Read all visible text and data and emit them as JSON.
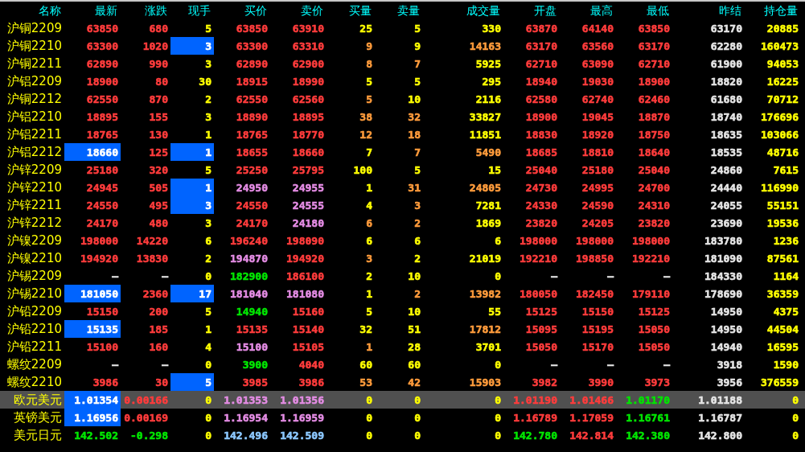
{
  "columns": [
    "名称",
    "最新",
    "涨跌",
    "现手",
    "买价",
    "卖价",
    "买量",
    "卖量",
    "成交量",
    "开盘",
    "最高",
    "最低",
    "昨结",
    "持仓量"
  ],
  "rows": [
    {
      "name": "沪铜2209",
      "selected": false,
      "cells": [
        {
          "text": "63850",
          "color": "#ff3c3c",
          "highlighted": false
        },
        {
          "text": "680",
          "color": "#ff3c3c",
          "highlighted": false
        },
        {
          "text": "5",
          "color": "#ffff00",
          "highlighted": false
        },
        {
          "text": "63850",
          "color": "#ff3c3c",
          "highlighted": false
        },
        {
          "text": "63910",
          "color": "#ff3c3c",
          "highlighted": false
        },
        {
          "text": "25",
          "color": "#ffff00",
          "highlighted": false
        },
        {
          "text": "5",
          "color": "#ffff00",
          "highlighted": false
        },
        {
          "text": "330",
          "color": "#ffff00",
          "highlighted": false
        },
        {
          "text": "63870",
          "color": "#ff3c3c",
          "highlighted": false
        },
        {
          "text": "64140",
          "color": "#ff3c3c",
          "highlighted": false
        },
        {
          "text": "63850",
          "color": "#ff3c3c",
          "highlighted": false
        },
        {
          "text": "63170",
          "color": "#e6e6e6",
          "highlighted": false
        },
        {
          "text": "20885",
          "color": "#ffff00",
          "highlighted": false
        }
      ]
    },
    {
      "name": "沪铜2210",
      "selected": false,
      "cells": [
        {
          "text": "63300",
          "color": "#ff3c3c",
          "highlighted": false
        },
        {
          "text": "1020",
          "color": "#ff3c3c",
          "highlighted": false
        },
        {
          "text": "3",
          "color": "#ffffff",
          "highlighted": true
        },
        {
          "text": "63300",
          "color": "#ff3c3c",
          "highlighted": false
        },
        {
          "text": "63310",
          "color": "#ff3c3c",
          "highlighted": false
        },
        {
          "text": "9",
          "color": "#ff9c3c",
          "highlighted": false
        },
        {
          "text": "9",
          "color": "#ffff00",
          "highlighted": false
        },
        {
          "text": "14163",
          "color": "#ff9c3c",
          "highlighted": false
        },
        {
          "text": "63170",
          "color": "#ff3c3c",
          "highlighted": false
        },
        {
          "text": "63560",
          "color": "#ff3c3c",
          "highlighted": false
        },
        {
          "text": "63170",
          "color": "#ff3c3c",
          "highlighted": false
        },
        {
          "text": "62280",
          "color": "#e6e6e6",
          "highlighted": false
        },
        {
          "text": "160473",
          "color": "#ffff00",
          "highlighted": false
        }
      ]
    },
    {
      "name": "沪铜2211",
      "selected": false,
      "cells": [
        {
          "text": "62890",
          "color": "#ff3c3c",
          "highlighted": false
        },
        {
          "text": "990",
          "color": "#ff3c3c",
          "highlighted": false
        },
        {
          "text": "3",
          "color": "#ffff00",
          "highlighted": false
        },
        {
          "text": "62890",
          "color": "#ff3c3c",
          "highlighted": false
        },
        {
          "text": "62900",
          "color": "#ff3c3c",
          "highlighted": false
        },
        {
          "text": "8",
          "color": "#ff9c3c",
          "highlighted": false
        },
        {
          "text": "7",
          "color": "#ff9c3c",
          "highlighted": false
        },
        {
          "text": "5925",
          "color": "#ffff00",
          "highlighted": false
        },
        {
          "text": "62710",
          "color": "#ff3c3c",
          "highlighted": false
        },
        {
          "text": "63090",
          "color": "#ff3c3c",
          "highlighted": false
        },
        {
          "text": "62710",
          "color": "#ff3c3c",
          "highlighted": false
        },
        {
          "text": "61900",
          "color": "#e6e6e6",
          "highlighted": false
        },
        {
          "text": "94053",
          "color": "#ffff00",
          "highlighted": false
        }
      ]
    },
    {
      "name": "沪铝2209",
      "selected": false,
      "cells": [
        {
          "text": "18900",
          "color": "#ff3c3c",
          "highlighted": false
        },
        {
          "text": "80",
          "color": "#ff3c3c",
          "highlighted": false
        },
        {
          "text": "30",
          "color": "#ffff00",
          "highlighted": false
        },
        {
          "text": "18915",
          "color": "#ff3c3c",
          "highlighted": false
        },
        {
          "text": "18990",
          "color": "#ff3c3c",
          "highlighted": false
        },
        {
          "text": "5",
          "color": "#ffff00",
          "highlighted": false
        },
        {
          "text": "5",
          "color": "#ffff00",
          "highlighted": false
        },
        {
          "text": "295",
          "color": "#ffff00",
          "highlighted": false
        },
        {
          "text": "18940",
          "color": "#ff3c3c",
          "highlighted": false
        },
        {
          "text": "19030",
          "color": "#ff3c3c",
          "highlighted": false
        },
        {
          "text": "18900",
          "color": "#ff3c3c",
          "highlighted": false
        },
        {
          "text": "18820",
          "color": "#e6e6e6",
          "highlighted": false
        },
        {
          "text": "16225",
          "color": "#ffff00",
          "highlighted": false
        }
      ]
    },
    {
      "name": "沪铜2212",
      "selected": false,
      "cells": [
        {
          "text": "62550",
          "color": "#ff3c3c",
          "highlighted": false
        },
        {
          "text": "870",
          "color": "#ff3c3c",
          "highlighted": false
        },
        {
          "text": "2",
          "color": "#ffff00",
          "highlighted": false
        },
        {
          "text": "62550",
          "color": "#ff3c3c",
          "highlighted": false
        },
        {
          "text": "62560",
          "color": "#ff3c3c",
          "highlighted": false
        },
        {
          "text": "5",
          "color": "#ff9c3c",
          "highlighted": false
        },
        {
          "text": "10",
          "color": "#ffff00",
          "highlighted": false
        },
        {
          "text": "2116",
          "color": "#ffff00",
          "highlighted": false
        },
        {
          "text": "62580",
          "color": "#ff3c3c",
          "highlighted": false
        },
        {
          "text": "62740",
          "color": "#ff3c3c",
          "highlighted": false
        },
        {
          "text": "62460",
          "color": "#ff3c3c",
          "highlighted": false
        },
        {
          "text": "61680",
          "color": "#e6e6e6",
          "highlighted": false
        },
        {
          "text": "70712",
          "color": "#ffff00",
          "highlighted": false
        }
      ]
    },
    {
      "name": "沪铝2210",
      "selected": false,
      "cells": [
        {
          "text": "18895",
          "color": "#ff3c3c",
          "highlighted": false
        },
        {
          "text": "155",
          "color": "#ff3c3c",
          "highlighted": false
        },
        {
          "text": "3",
          "color": "#ffff00",
          "highlighted": false
        },
        {
          "text": "18890",
          "color": "#ff3c3c",
          "highlighted": false
        },
        {
          "text": "18895",
          "color": "#ff3c3c",
          "highlighted": false
        },
        {
          "text": "38",
          "color": "#ff9c3c",
          "highlighted": false
        },
        {
          "text": "32",
          "color": "#ff9c3c",
          "highlighted": false
        },
        {
          "text": "33827",
          "color": "#ffff00",
          "highlighted": false
        },
        {
          "text": "18900",
          "color": "#ff3c3c",
          "highlighted": false
        },
        {
          "text": "19045",
          "color": "#ff3c3c",
          "highlighted": false
        },
        {
          "text": "18870",
          "color": "#ff3c3c",
          "highlighted": false
        },
        {
          "text": "18740",
          "color": "#e6e6e6",
          "highlighted": false
        },
        {
          "text": "176696",
          "color": "#ffff00",
          "highlighted": false
        }
      ]
    },
    {
      "name": "沪铝2211",
      "selected": false,
      "cells": [
        {
          "text": "18765",
          "color": "#ff3c3c",
          "highlighted": false
        },
        {
          "text": "130",
          "color": "#ff3c3c",
          "highlighted": false
        },
        {
          "text": "1",
          "color": "#ffff00",
          "highlighted": false
        },
        {
          "text": "18765",
          "color": "#ff3c3c",
          "highlighted": false
        },
        {
          "text": "18770",
          "color": "#ff3c3c",
          "highlighted": false
        },
        {
          "text": "12",
          "color": "#ff9c3c",
          "highlighted": false
        },
        {
          "text": "18",
          "color": "#ff9c3c",
          "highlighted": false
        },
        {
          "text": "11851",
          "color": "#ffff00",
          "highlighted": false
        },
        {
          "text": "18830",
          "color": "#ff3c3c",
          "highlighted": false
        },
        {
          "text": "18920",
          "color": "#ff3c3c",
          "highlighted": false
        },
        {
          "text": "18750",
          "color": "#ff3c3c",
          "highlighted": false
        },
        {
          "text": "18635",
          "color": "#e6e6e6",
          "highlighted": false
        },
        {
          "text": "103066",
          "color": "#ffff00",
          "highlighted": false
        }
      ]
    },
    {
      "name": "沪铝2212",
      "selected": false,
      "cells": [
        {
          "text": "18660",
          "color": "#ffffff",
          "highlighted": true
        },
        {
          "text": "125",
          "color": "#ff3c3c",
          "highlighted": false
        },
        {
          "text": "1",
          "color": "#ffffff",
          "highlighted": true
        },
        {
          "text": "18655",
          "color": "#ff3c3c",
          "highlighted": false
        },
        {
          "text": "18660",
          "color": "#ff3c3c",
          "highlighted": false
        },
        {
          "text": "7",
          "color": "#ffff00",
          "highlighted": false
        },
        {
          "text": "7",
          "color": "#ff9c3c",
          "highlighted": false
        },
        {
          "text": "5490",
          "color": "#ff9c3c",
          "highlighted": false
        },
        {
          "text": "18685",
          "color": "#ff3c3c",
          "highlighted": false
        },
        {
          "text": "18810",
          "color": "#ff3c3c",
          "highlighted": false
        },
        {
          "text": "18640",
          "color": "#ff3c3c",
          "highlighted": false
        },
        {
          "text": "18535",
          "color": "#e6e6e6",
          "highlighted": false
        },
        {
          "text": "48716",
          "color": "#ffff00",
          "highlighted": false
        }
      ]
    },
    {
      "name": "沪锌2209",
      "selected": false,
      "cells": [
        {
          "text": "25180",
          "color": "#ff3c3c",
          "highlighted": false
        },
        {
          "text": "320",
          "color": "#ff3c3c",
          "highlighted": false
        },
        {
          "text": "5",
          "color": "#ffff00",
          "highlighted": false
        },
        {
          "text": "25250",
          "color": "#ff3c3c",
          "highlighted": false
        },
        {
          "text": "25795",
          "color": "#ff3c3c",
          "highlighted": false
        },
        {
          "text": "100",
          "color": "#ffff00",
          "highlighted": false
        },
        {
          "text": "5",
          "color": "#ffff00",
          "highlighted": false
        },
        {
          "text": "15",
          "color": "#ffff00",
          "highlighted": false
        },
        {
          "text": "25040",
          "color": "#ff3c3c",
          "highlighted": false
        },
        {
          "text": "25180",
          "color": "#ff3c3c",
          "highlighted": false
        },
        {
          "text": "25040",
          "color": "#ff3c3c",
          "highlighted": false
        },
        {
          "text": "24860",
          "color": "#e6e6e6",
          "highlighted": false
        },
        {
          "text": "7615",
          "color": "#ffff00",
          "highlighted": false
        }
      ]
    },
    {
      "name": "沪锌2210",
      "selected": false,
      "cells": [
        {
          "text": "24945",
          "color": "#ff3c3c",
          "highlighted": false
        },
        {
          "text": "505",
          "color": "#ff3c3c",
          "highlighted": false
        },
        {
          "text": "1",
          "color": "#ffffff",
          "highlighted": true
        },
        {
          "text": "24950",
          "color": "#e48ce4",
          "highlighted": false
        },
        {
          "text": "24955",
          "color": "#e48ce4",
          "highlighted": false
        },
        {
          "text": "1",
          "color": "#ffff00",
          "highlighted": false
        },
        {
          "text": "31",
          "color": "#ff9c3c",
          "highlighted": false
        },
        {
          "text": "24805",
          "color": "#ff9c3c",
          "highlighted": false
        },
        {
          "text": "24730",
          "color": "#ff3c3c",
          "highlighted": false
        },
        {
          "text": "24995",
          "color": "#ff3c3c",
          "highlighted": false
        },
        {
          "text": "24700",
          "color": "#ff3c3c",
          "highlighted": false
        },
        {
          "text": "24440",
          "color": "#e6e6e6",
          "highlighted": false
        },
        {
          "text": "116990",
          "color": "#ffff00",
          "highlighted": false
        }
      ]
    },
    {
      "name": "沪锌2211",
      "selected": false,
      "cells": [
        {
          "text": "24550",
          "color": "#ff3c3c",
          "highlighted": false
        },
        {
          "text": "495",
          "color": "#ff3c3c",
          "highlighted": false
        },
        {
          "text": "3",
          "color": "#ffffff",
          "highlighted": true
        },
        {
          "text": "24550",
          "color": "#ff3c3c",
          "highlighted": false
        },
        {
          "text": "24555",
          "color": "#e48ce4",
          "highlighted": false
        },
        {
          "text": "4",
          "color": "#ffff00",
          "highlighted": false
        },
        {
          "text": "3",
          "color": "#ff9c3c",
          "highlighted": false
        },
        {
          "text": "7281",
          "color": "#ffff00",
          "highlighted": false
        },
        {
          "text": "24330",
          "color": "#ff3c3c",
          "highlighted": false
        },
        {
          "text": "24590",
          "color": "#ff3c3c",
          "highlighted": false
        },
        {
          "text": "24310",
          "color": "#ff3c3c",
          "highlighted": false
        },
        {
          "text": "24055",
          "color": "#e6e6e6",
          "highlighted": false
        },
        {
          "text": "55151",
          "color": "#ffff00",
          "highlighted": false
        }
      ]
    },
    {
      "name": "沪锌2212",
      "selected": false,
      "cells": [
        {
          "text": "24170",
          "color": "#ff3c3c",
          "highlighted": false
        },
        {
          "text": "480",
          "color": "#ff3c3c",
          "highlighted": false
        },
        {
          "text": "3",
          "color": "#ffff00",
          "highlighted": false
        },
        {
          "text": "24170",
          "color": "#ff3c3c",
          "highlighted": false
        },
        {
          "text": "24180",
          "color": "#e48ce4",
          "highlighted": false
        },
        {
          "text": "6",
          "color": "#ff9c3c",
          "highlighted": false
        },
        {
          "text": "2",
          "color": "#ff9c3c",
          "highlighted": false
        },
        {
          "text": "1869",
          "color": "#ffff00",
          "highlighted": false
        },
        {
          "text": "23820",
          "color": "#ff3c3c",
          "highlighted": false
        },
        {
          "text": "24205",
          "color": "#ff3c3c",
          "highlighted": false
        },
        {
          "text": "23820",
          "color": "#ff3c3c",
          "highlighted": false
        },
        {
          "text": "23690",
          "color": "#e6e6e6",
          "highlighted": false
        },
        {
          "text": "19536",
          "color": "#ffff00",
          "highlighted": false
        }
      ]
    },
    {
      "name": "沪镍2209",
      "selected": false,
      "cells": [
        {
          "text": "198000",
          "color": "#ff3c3c",
          "highlighted": false
        },
        {
          "text": "14220",
          "color": "#ff3c3c",
          "highlighted": false
        },
        {
          "text": "6",
          "color": "#ffff00",
          "highlighted": false
        },
        {
          "text": "196240",
          "color": "#ff3c3c",
          "highlighted": false
        },
        {
          "text": "198090",
          "color": "#ff3c3c",
          "highlighted": false
        },
        {
          "text": "6",
          "color": "#ffff00",
          "highlighted": false
        },
        {
          "text": "6",
          "color": "#ffff00",
          "highlighted": false
        },
        {
          "text": "6",
          "color": "#ffff00",
          "highlighted": false
        },
        {
          "text": "198000",
          "color": "#ff3c3c",
          "highlighted": false
        },
        {
          "text": "198000",
          "color": "#ff3c3c",
          "highlighted": false
        },
        {
          "text": "198000",
          "color": "#ff3c3c",
          "highlighted": false
        },
        {
          "text": "183780",
          "color": "#e6e6e6",
          "highlighted": false
        },
        {
          "text": "1236",
          "color": "#ffff00",
          "highlighted": false
        }
      ]
    },
    {
      "name": "沪镍2210",
      "selected": false,
      "cells": [
        {
          "text": "194920",
          "color": "#ff3c3c",
          "highlighted": false
        },
        {
          "text": "13830",
          "color": "#ff3c3c",
          "highlighted": false
        },
        {
          "text": "2",
          "color": "#ffff00",
          "highlighted": false
        },
        {
          "text": "194870",
          "color": "#e48ce4",
          "highlighted": false
        },
        {
          "text": "194920",
          "color": "#ff3c3c",
          "highlighted": false
        },
        {
          "text": "3",
          "color": "#ff9c3c",
          "highlighted": false
        },
        {
          "text": "2",
          "color": "#ffff00",
          "highlighted": false
        },
        {
          "text": "21019",
          "color": "#ffff00",
          "highlighted": false
        },
        {
          "text": "192210",
          "color": "#ff3c3c",
          "highlighted": false
        },
        {
          "text": "198850",
          "color": "#ff3c3c",
          "highlighted": false
        },
        {
          "text": "192210",
          "color": "#ff3c3c",
          "highlighted": false
        },
        {
          "text": "181090",
          "color": "#e6e6e6",
          "highlighted": false
        },
        {
          "text": "87561",
          "color": "#ffff00",
          "highlighted": false
        }
      ]
    },
    {
      "name": "沪锡2209",
      "selected": false,
      "cells": [
        {
          "text": "—",
          "color": "#e6e6e6",
          "highlighted": false
        },
        {
          "text": "—",
          "color": "#e6e6e6",
          "highlighted": false
        },
        {
          "text": "0",
          "color": "#ffff00",
          "highlighted": false
        },
        {
          "text": "182900",
          "color": "#00e600",
          "highlighted": false
        },
        {
          "text": "186100",
          "color": "#ff3c3c",
          "highlighted": false
        },
        {
          "text": "2",
          "color": "#ffff00",
          "highlighted": false
        },
        {
          "text": "10",
          "color": "#ffff00",
          "highlighted": false
        },
        {
          "text": "0",
          "color": "#ffff00",
          "highlighted": false
        },
        {
          "text": "—",
          "color": "#e6e6e6",
          "highlighted": false
        },
        {
          "text": "—",
          "color": "#e6e6e6",
          "highlighted": false
        },
        {
          "text": "—",
          "color": "#e6e6e6",
          "highlighted": false
        },
        {
          "text": "184330",
          "color": "#e6e6e6",
          "highlighted": false
        },
        {
          "text": "1164",
          "color": "#ffff00",
          "highlighted": false
        }
      ]
    },
    {
      "name": "沪锡2210",
      "selected": false,
      "cells": [
        {
          "text": "181050",
          "color": "#ffffff",
          "highlighted": true
        },
        {
          "text": "2360",
          "color": "#ff3c3c",
          "highlighted": false
        },
        {
          "text": "17",
          "color": "#ffffff",
          "highlighted": true
        },
        {
          "text": "181040",
          "color": "#e48ce4",
          "highlighted": false
        },
        {
          "text": "181080",
          "color": "#e48ce4",
          "highlighted": false
        },
        {
          "text": "1",
          "color": "#ffff00",
          "highlighted": false
        },
        {
          "text": "2",
          "color": "#ff9c3c",
          "highlighted": false
        },
        {
          "text": "13982",
          "color": "#ff9c3c",
          "highlighted": false
        },
        {
          "text": "180050",
          "color": "#ff3c3c",
          "highlighted": false
        },
        {
          "text": "182450",
          "color": "#ff3c3c",
          "highlighted": false
        },
        {
          "text": "179110",
          "color": "#ff3c3c",
          "highlighted": false
        },
        {
          "text": "178690",
          "color": "#e6e6e6",
          "highlighted": false
        },
        {
          "text": "36359",
          "color": "#ffff00",
          "highlighted": false
        }
      ]
    },
    {
      "name": "沪铅2209",
      "selected": false,
      "cells": [
        {
          "text": "15150",
          "color": "#ff3c3c",
          "highlighted": false
        },
        {
          "text": "200",
          "color": "#ff3c3c",
          "highlighted": false
        },
        {
          "text": "5",
          "color": "#ffff00",
          "highlighted": false
        },
        {
          "text": "14940",
          "color": "#00e600",
          "highlighted": false
        },
        {
          "text": "15160",
          "color": "#ff3c3c",
          "highlighted": false
        },
        {
          "text": "5",
          "color": "#ffff00",
          "highlighted": false
        },
        {
          "text": "10",
          "color": "#ffff00",
          "highlighted": false
        },
        {
          "text": "55",
          "color": "#ffff00",
          "highlighted": false
        },
        {
          "text": "15125",
          "color": "#ff3c3c",
          "highlighted": false
        },
        {
          "text": "15150",
          "color": "#ff3c3c",
          "highlighted": false
        },
        {
          "text": "15125",
          "color": "#ff3c3c",
          "highlighted": false
        },
        {
          "text": "14950",
          "color": "#e6e6e6",
          "highlighted": false
        },
        {
          "text": "4375",
          "color": "#ffff00",
          "highlighted": false
        }
      ]
    },
    {
      "name": "沪铅2210",
      "selected": false,
      "cells": [
        {
          "text": "15135",
          "color": "#ffffff",
          "highlighted": true
        },
        {
          "text": "185",
          "color": "#ff3c3c",
          "highlighted": false
        },
        {
          "text": "1",
          "color": "#ffff00",
          "highlighted": false
        },
        {
          "text": "15135",
          "color": "#ff3c3c",
          "highlighted": false
        },
        {
          "text": "15140",
          "color": "#ff3c3c",
          "highlighted": false
        },
        {
          "text": "32",
          "color": "#ffff00",
          "highlighted": false
        },
        {
          "text": "51",
          "color": "#ffff00",
          "highlighted": false
        },
        {
          "text": "17812",
          "color": "#ff9c3c",
          "highlighted": false
        },
        {
          "text": "15095",
          "color": "#ff3c3c",
          "highlighted": false
        },
        {
          "text": "15195",
          "color": "#ff3c3c",
          "highlighted": false
        },
        {
          "text": "15050",
          "color": "#ff3c3c",
          "highlighted": false
        },
        {
          "text": "14950",
          "color": "#e6e6e6",
          "highlighted": false
        },
        {
          "text": "44504",
          "color": "#ffff00",
          "highlighted": false
        }
      ]
    },
    {
      "name": "沪铅2211",
      "selected": false,
      "cells": [
        {
          "text": "15100",
          "color": "#ff3c3c",
          "highlighted": false
        },
        {
          "text": "160",
          "color": "#ff3c3c",
          "highlighted": false
        },
        {
          "text": "4",
          "color": "#ffff00",
          "highlighted": false
        },
        {
          "text": "15100",
          "color": "#e48ce4",
          "highlighted": false
        },
        {
          "text": "15105",
          "color": "#ff3c3c",
          "highlighted": false
        },
        {
          "text": "1",
          "color": "#ff9c3c",
          "highlighted": false
        },
        {
          "text": "28",
          "color": "#ffff00",
          "highlighted": false
        },
        {
          "text": "3701",
          "color": "#ffff00",
          "highlighted": false
        },
        {
          "text": "15050",
          "color": "#ff3c3c",
          "highlighted": false
        },
        {
          "text": "15170",
          "color": "#ff3c3c",
          "highlighted": false
        },
        {
          "text": "15050",
          "color": "#ff3c3c",
          "highlighted": false
        },
        {
          "text": "14940",
          "color": "#e6e6e6",
          "highlighted": false
        },
        {
          "text": "16595",
          "color": "#ffff00",
          "highlighted": false
        }
      ]
    },
    {
      "name": "螺纹2209",
      "selected": false,
      "cells": [
        {
          "text": "—",
          "color": "#e6e6e6",
          "highlighted": false
        },
        {
          "text": "—",
          "color": "#e6e6e6",
          "highlighted": false
        },
        {
          "text": "0",
          "color": "#ffff00",
          "highlighted": false
        },
        {
          "text": "3900",
          "color": "#00e600",
          "highlighted": false
        },
        {
          "text": "4040",
          "color": "#ff3c3c",
          "highlighted": false
        },
        {
          "text": "60",
          "color": "#ffff00",
          "highlighted": false
        },
        {
          "text": "60",
          "color": "#ffff00",
          "highlighted": false
        },
        {
          "text": "0",
          "color": "#ffff00",
          "highlighted": false
        },
        {
          "text": "—",
          "color": "#e6e6e6",
          "highlighted": false
        },
        {
          "text": "—",
          "color": "#e6e6e6",
          "highlighted": false
        },
        {
          "text": "—",
          "color": "#e6e6e6",
          "highlighted": false
        },
        {
          "text": "3918",
          "color": "#e6e6e6",
          "highlighted": false
        },
        {
          "text": "1590",
          "color": "#ffff00",
          "highlighted": false
        }
      ]
    },
    {
      "name": "螺纹2210",
      "selected": false,
      "cells": [
        {
          "text": "3986",
          "color": "#ff3c3c",
          "highlighted": false
        },
        {
          "text": "30",
          "color": "#ff3c3c",
          "highlighted": false
        },
        {
          "text": "5",
          "color": "#ffffff",
          "highlighted": true
        },
        {
          "text": "3985",
          "color": "#ff3c3c",
          "highlighted": false
        },
        {
          "text": "3986",
          "color": "#ff3c3c",
          "highlighted": false
        },
        {
          "text": "53",
          "color": "#ff9c3c",
          "highlighted": false
        },
        {
          "text": "42",
          "color": "#ff9c3c",
          "highlighted": false
        },
        {
          "text": "15903",
          "color": "#ff9c3c",
          "highlighted": false
        },
        {
          "text": "3982",
          "color": "#ff3c3c",
          "highlighted": false
        },
        {
          "text": "3990",
          "color": "#ff3c3c",
          "highlighted": false
        },
        {
          "text": "3973",
          "color": "#ff3c3c",
          "highlighted": false
        },
        {
          "text": "3956",
          "color": "#e6e6e6",
          "highlighted": false
        },
        {
          "text": "376559",
          "color": "#ffff00",
          "highlighted": false
        }
      ]
    },
    {
      "name": "欧元美元",
      "selected": true,
      "cells": [
        {
          "text": "1.01354",
          "color": "#ffffff",
          "highlighted": true
        },
        {
          "text": "0.00166",
          "color": "#ff3c3c",
          "highlighted": false
        },
        {
          "text": "0",
          "color": "#ffff00",
          "highlighted": false
        },
        {
          "text": "1.01353",
          "color": "#e48ce4",
          "highlighted": false
        },
        {
          "text": "1.01356",
          "color": "#e48ce4",
          "highlighted": false
        },
        {
          "text": "0",
          "color": "#ffff00",
          "highlighted": false
        },
        {
          "text": "0",
          "color": "#ffff00",
          "highlighted": false
        },
        {
          "text": "0",
          "color": "#ffff00",
          "highlighted": false
        },
        {
          "text": "1.01190",
          "color": "#ff3c3c",
          "highlighted": false
        },
        {
          "text": "1.01466",
          "color": "#ff3c3c",
          "highlighted": false
        },
        {
          "text": "1.01170",
          "color": "#00e600",
          "highlighted": false
        },
        {
          "text": "1.01188",
          "color": "#e6e6e6",
          "highlighted": false
        },
        {
          "text": "0",
          "color": "#ffff00",
          "highlighted": false
        }
      ]
    },
    {
      "name": "英镑美元",
      "selected": false,
      "cells": [
        {
          "text": "1.16956",
          "color": "#ffffff",
          "highlighted": true
        },
        {
          "text": "0.00169",
          "color": "#ff3c3c",
          "highlighted": false
        },
        {
          "text": "0",
          "color": "#ffff00",
          "highlighted": false
        },
        {
          "text": "1.16954",
          "color": "#e48ce4",
          "highlighted": false
        },
        {
          "text": "1.16959",
          "color": "#e48ce4",
          "highlighted": false
        },
        {
          "text": "0",
          "color": "#ffff00",
          "highlighted": false
        },
        {
          "text": "0",
          "color": "#ffff00",
          "highlighted": false
        },
        {
          "text": "0",
          "color": "#ffff00",
          "highlighted": false
        },
        {
          "text": "1.16789",
          "color": "#ff3c3c",
          "highlighted": false
        },
        {
          "text": "1.17059",
          "color": "#ff3c3c",
          "highlighted": false
        },
        {
          "text": "1.16761",
          "color": "#00e600",
          "highlighted": false
        },
        {
          "text": "1.16787",
          "color": "#e6e6e6",
          "highlighted": false
        },
        {
          "text": "0",
          "color": "#ffff00",
          "highlighted": false
        }
      ]
    },
    {
      "name": "美元日元",
      "selected": false,
      "cells": [
        {
          "text": "142.502",
          "color": "#00e600",
          "highlighted": false
        },
        {
          "text": "-0.298",
          "color": "#00e600",
          "highlighted": false
        },
        {
          "text": "0",
          "color": "#ffff00",
          "highlighted": false
        },
        {
          "text": "142.496",
          "color": "#8cc8ff",
          "highlighted": false
        },
        {
          "text": "142.509",
          "color": "#8cc8ff",
          "highlighted": false
        },
        {
          "text": "0",
          "color": "#ffff00",
          "highlighted": false
        },
        {
          "text": "0",
          "color": "#ffff00",
          "highlighted": false
        },
        {
          "text": "0",
          "color": "#ffff00",
          "highlighted": false
        },
        {
          "text": "142.780",
          "color": "#00e600",
          "highlighted": false
        },
        {
          "text": "142.814",
          "color": "#ff3c3c",
          "highlighted": false
        },
        {
          "text": "142.380",
          "color": "#00e600",
          "highlighted": false
        },
        {
          "text": "142.800",
          "color": "#e6e6e6",
          "highlighted": false
        },
        {
          "text": "0",
          "color": "#ffff00",
          "highlighted": false
        }
      ]
    }
  ]
}
